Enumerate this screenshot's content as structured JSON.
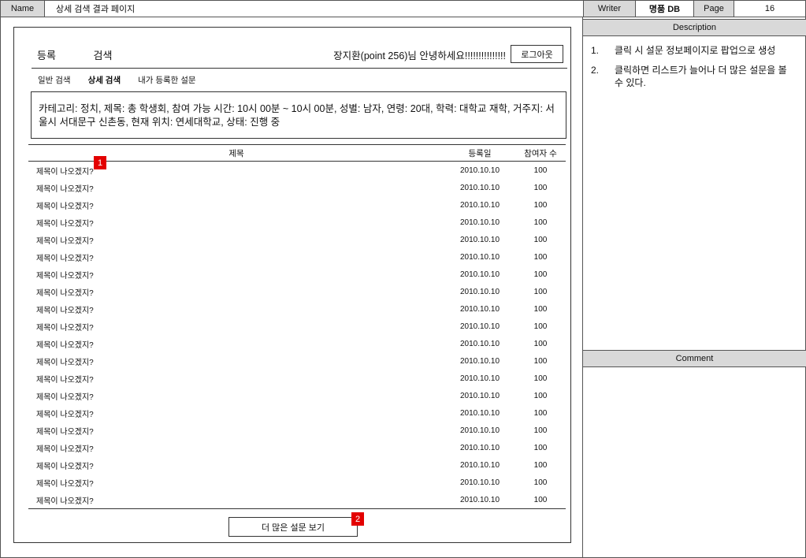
{
  "doc_header": {
    "name_label": "Name",
    "name_value": "상세 검색 결과 페이지",
    "writer_label": "Writer",
    "writer_value": "명품 DB",
    "page_label": "Page",
    "page_value": "16"
  },
  "description": {
    "title": "Description",
    "items": [
      {
        "num": "1.",
        "text": "클릭 시 설문 정보페이지로 팝업으로 생성"
      },
      {
        "num": "2.",
        "text": "클릭하면 리스트가 늘어나 더 많은 설문을 볼 수 있다."
      }
    ]
  },
  "comment": {
    "title": "Comment"
  },
  "app": {
    "nav": {
      "register": "등록",
      "search": "검색"
    },
    "greeting": "장지환(point 256)님 안녕하세요!!!!!!!!!!!!!!!",
    "logout_label": "로그아웃",
    "subtabs": {
      "basic": "일반 검색",
      "detail": "상세 검색",
      "mine": "내가 등록한 설문"
    },
    "criteria": "카테고리: 정치, 제목: 총 학생회, 참여 가능 시간: 10시 00분 ~ 10시 00분, 성별: 남자, 연령: 20대, 학력: 대학교 재학, 거주지: 서울시 서대문구 신촌동, 현재 위치: 연세대학교, 상태: 진행 중",
    "table": {
      "headers": {
        "title": "제목",
        "date": "등록일",
        "count": "참여자 수"
      },
      "rows": [
        {
          "title": "제목이 나오겠지?",
          "date": "2010.10.10",
          "count": "100"
        },
        {
          "title": "제목이 나오겠지?",
          "date": "2010.10.10",
          "count": "100"
        },
        {
          "title": "제목이 나오겠지?",
          "date": "2010.10.10",
          "count": "100"
        },
        {
          "title": "제목이 나오겠지?",
          "date": "2010.10.10",
          "count": "100"
        },
        {
          "title": "제목이 나오겠지?",
          "date": "2010.10.10",
          "count": "100"
        },
        {
          "title": "제목이 나오겠지?",
          "date": "2010.10.10",
          "count": "100"
        },
        {
          "title": "제목이 나오겠지?",
          "date": "2010.10.10",
          "count": "100"
        },
        {
          "title": "제목이 나오겠지?",
          "date": "2010.10.10",
          "count": "100"
        },
        {
          "title": "제목이 나오겠지?",
          "date": "2010.10.10",
          "count": "100"
        },
        {
          "title": "제목이 나오겠지?",
          "date": "2010.10.10",
          "count": "100"
        },
        {
          "title": "제목이 나오겠지?",
          "date": "2010.10.10",
          "count": "100"
        },
        {
          "title": "제목이 나오겠지?",
          "date": "2010.10.10",
          "count": "100"
        },
        {
          "title": "제목이 나오겠지?",
          "date": "2010.10.10",
          "count": "100"
        },
        {
          "title": "제목이 나오겠지?",
          "date": "2010.10.10",
          "count": "100"
        },
        {
          "title": "제목이 나오겠지?",
          "date": "2010.10.10",
          "count": "100"
        },
        {
          "title": "제목이 나오겠지?",
          "date": "2010.10.10",
          "count": "100"
        },
        {
          "title": "제목이 나오겠지?",
          "date": "2010.10.10",
          "count": "100"
        },
        {
          "title": "제목이 나오겠지?",
          "date": "2010.10.10",
          "count": "100"
        },
        {
          "title": "제목이 나오겠지?",
          "date": "2010.10.10",
          "count": "100"
        },
        {
          "title": "제목이 나오겠지?",
          "date": "2010.10.10",
          "count": "100"
        }
      ]
    },
    "more_label": "더 많은 설문 보기"
  },
  "markers": [
    "1",
    "2"
  ],
  "colors": {
    "marker": "#e30000",
    "header_gray": "#d9d9d9"
  }
}
